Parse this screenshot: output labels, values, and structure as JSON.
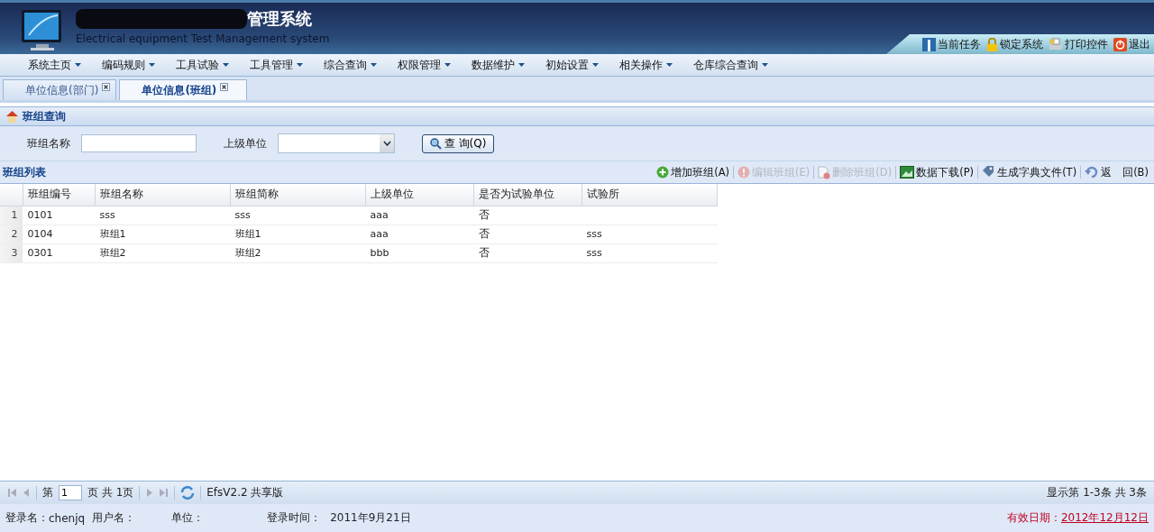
{
  "header": {
    "title": "管理系统",
    "subtitle": "Electrical equipment Test  Management system",
    "links": [
      {
        "label": "当前任务",
        "kind": "tasks"
      },
      {
        "label": "锁定系统",
        "kind": "lock"
      },
      {
        "label": "打印控件",
        "kind": "print"
      },
      {
        "label": "退出",
        "kind": "exit"
      }
    ]
  },
  "menu": [
    "系统主页",
    "编码规则",
    "工具试验",
    "工具管理",
    "综合查询",
    "权限管理",
    "数据维护",
    "初始设置",
    "相关操作",
    "仓库综合查询"
  ],
  "tabs": [
    {
      "label": "单位信息(部门)",
      "selected": false
    },
    {
      "label": "单位信息(班组)",
      "selected": true
    }
  ],
  "search_panel": {
    "title": "班组查询",
    "fields": [
      {
        "label": "班组名称",
        "kind": "text"
      },
      {
        "label": "上级单位",
        "kind": "select"
      }
    ],
    "button": "查 询(Q)"
  },
  "list": {
    "title": "班组列表",
    "actions": [
      {
        "label": "增加班组(A)",
        "kind": "add",
        "disabled": false
      },
      {
        "label": "编辑班组(E)",
        "kind": "edit",
        "disabled": true
      },
      {
        "label": "删除班组(D)",
        "kind": "delete",
        "disabled": true
      },
      {
        "label": "数据下载(P)",
        "kind": "download",
        "disabled": false
      },
      {
        "label": "生成字典文件(T)",
        "kind": "tag",
        "disabled": false
      },
      {
        "label": "返　回(B)",
        "kind": "back",
        "disabled": false
      }
    ],
    "columns": [
      "班组编号",
      "班组名称",
      "班组简称",
      "上级单位",
      "是否为试验单位",
      "试验所"
    ],
    "rows": [
      {
        "index": "1",
        "cells": [
          "0101",
          "sss",
          "sss",
          "aaa",
          "否",
          ""
        ]
      },
      {
        "index": "2",
        "cells": [
          "0104",
          "班组1",
          "班组1",
          "aaa",
          "否",
          "sss"
        ]
      },
      {
        "index": "3",
        "cells": [
          "0301",
          "班组2",
          "班组2",
          "bbb",
          "否",
          "sss"
        ]
      }
    ]
  },
  "pager": {
    "page_prefix": "第",
    "page": "1",
    "page_suffix": "页 共 1页",
    "version": "EfsV2.2 共享版",
    "summary": "显示第 1-3条 共 3条"
  },
  "status_bar": {
    "login_label": "登录名：",
    "login": "chenjq",
    "user_label": "用户名：",
    "unit_label": "单位：",
    "time_label": "登录时间：",
    "time": "2011年9月21日",
    "expiry_label": "有效日期：",
    "expiry": "2012年12月12日"
  }
}
